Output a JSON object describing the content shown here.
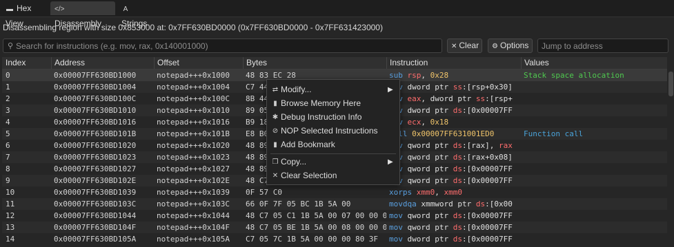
{
  "tabs": [
    {
      "label": "Hex View",
      "icon": "hex-view-icon",
      "glyph": "▬"
    },
    {
      "label": "Disassembly",
      "icon": "code-icon",
      "glyph": "</>"
    },
    {
      "label": "Strings",
      "icon": "strings-icon",
      "glyph": "A"
    }
  ],
  "info": "Disassembling region with size 0x853000 at: 0x7FF630BD0000  (0x7FF630BD0000 - 0x7FF631423000)",
  "toolbar": {
    "search_placeholder": "Search for instructions (e.g. mov, rax, 0x140001000)",
    "clear_label": "Clear",
    "options_label": "Options",
    "address_placeholder": "Jump to address"
  },
  "columns": [
    "Index",
    "Address",
    "Offset",
    "Bytes",
    "Instruction",
    "Values"
  ],
  "rows": [
    {
      "index": "0",
      "address": "0x00007FF630BD1000",
      "offset": "notepad+++0x1000",
      "bytes": "48 83 EC 28",
      "mnemonic": "sub",
      "operands": [
        [
          "rsp",
          "reg"
        ],
        [
          ", ",
          "kw"
        ],
        [
          "0x28",
          "num"
        ]
      ],
      "value": "Stack space allocation"
    },
    {
      "index": "1",
      "address": "0x00007FF630BD1004",
      "offset": "notepad+++0x1004",
      "bytes": "C7 44",
      "mnemonic": "mov",
      "operands": [
        [
          "dword ptr ",
          "kw"
        ],
        [
          "ss",
          "seg"
        ],
        [
          ":[rsp+0x30]",
          "kw"
        ]
      ],
      "value": ""
    },
    {
      "index": "2",
      "address": "0x00007FF630BD100C",
      "offset": "notepad+++0x100C",
      "bytes": "8B 44",
      "mnemonic": "mov",
      "operands": [
        [
          "eax",
          "reg"
        ],
        [
          ", dword ptr ",
          "kw"
        ],
        [
          "ss",
          "seg"
        ],
        [
          ":[rsp+",
          "kw"
        ]
      ],
      "value": ""
    },
    {
      "index": "3",
      "address": "0x00007FF630BD1010",
      "offset": "notepad+++0x1010",
      "bytes": "89 05",
      "mnemonic": "mov",
      "operands": [
        [
          "dword ptr ",
          "kw"
        ],
        [
          "ds",
          "seg"
        ],
        [
          ":[0x00007FF",
          "kw"
        ]
      ],
      "value": ""
    },
    {
      "index": "4",
      "address": "0x00007FF630BD1016",
      "offset": "notepad+++0x1016",
      "bytes": "B9 18",
      "mnemonic": "mov",
      "operands": [
        [
          "ecx",
          "reg"
        ],
        [
          ", ",
          "kw"
        ],
        [
          "0x18",
          "num"
        ]
      ],
      "value": ""
    },
    {
      "index": "5",
      "address": "0x00007FF630BD101B",
      "offset": "notepad+++0x101B",
      "bytes": "E8 B0",
      "mnemonic": "call",
      "operands": [
        [
          "0x00007FF631001ED0",
          "num"
        ]
      ],
      "value": "Function call"
    },
    {
      "index": "6",
      "address": "0x00007FF630BD1020",
      "offset": "notepad+++0x1020",
      "bytes": "48 89",
      "mnemonic": "mov",
      "operands": [
        [
          "qword ptr ",
          "kw"
        ],
        [
          "ds",
          "seg"
        ],
        [
          ":[rax], ",
          "kw"
        ],
        [
          "rax",
          "reg"
        ]
      ],
      "value": ""
    },
    {
      "index": "7",
      "address": "0x00007FF630BD1023",
      "offset": "notepad+++0x1023",
      "bytes": "48 89",
      "mnemonic": "mov",
      "operands": [
        [
          "qword ptr ",
          "kw"
        ],
        [
          "ds",
          "seg"
        ],
        [
          ":[rax+0x08]",
          "kw"
        ]
      ],
      "value": ""
    },
    {
      "index": "8",
      "address": "0x00007FF630BD1027",
      "offset": "notepad+++0x1027",
      "bytes": "48 89",
      "mnemonic": "mov",
      "operands": [
        [
          "qword ptr ",
          "kw"
        ],
        [
          "ds",
          "seg"
        ],
        [
          ":[0x00007FF",
          "kw"
        ]
      ],
      "value": ""
    },
    {
      "index": "9",
      "address": "0x00007FF630BD102E",
      "offset": "notepad+++0x102E",
      "bytes": "48 C7",
      "mnemonic": "mov",
      "operands": [
        [
          "qword ptr ",
          "kw"
        ],
        [
          "ds",
          "seg"
        ],
        [
          ":[0x00007FF",
          "kw"
        ]
      ],
      "value": ""
    },
    {
      "index": "10",
      "address": "0x00007FF630BD1039",
      "offset": "notepad+++0x1039",
      "bytes": "0F 57 C0",
      "mnemonic": "xorps",
      "operands": [
        [
          "xmm0",
          "reg"
        ],
        [
          ", ",
          "kw"
        ],
        [
          "xmm0",
          "reg"
        ]
      ],
      "value": ""
    },
    {
      "index": "11",
      "address": "0x00007FF630BD103C",
      "offset": "notepad+++0x103C",
      "bytes": "66 0F 7F 05 BC 1B 5A 00",
      "mnemonic": "movdqa",
      "operands": [
        [
          "xmmword ptr ",
          "kw"
        ],
        [
          "ds",
          "seg"
        ],
        [
          ":[0x00",
          "kw"
        ]
      ],
      "value": ""
    },
    {
      "index": "12",
      "address": "0x00007FF630BD1044",
      "offset": "notepad+++0x1044",
      "bytes": "48 C7 05 C1 1B 5A 00 07 00 00 00",
      "mnemonic": "mov",
      "operands": [
        [
          "qword ptr ",
          "kw"
        ],
        [
          "ds",
          "seg"
        ],
        [
          ":[0x00007FF",
          "kw"
        ]
      ],
      "value": ""
    },
    {
      "index": "13",
      "address": "0x00007FF630BD104F",
      "offset": "notepad+++0x104F",
      "bytes": "48 C7 05 BE 1B 5A 00 08 00 00 00",
      "mnemonic": "mov",
      "operands": [
        [
          "qword ptr ",
          "kw"
        ],
        [
          "ds",
          "seg"
        ],
        [
          ":[0x00007FF",
          "kw"
        ]
      ],
      "value": ""
    },
    {
      "index": "14",
      "address": "0x00007FF630BD105A",
      "offset": "notepad+++0x105A",
      "bytes": "C7 05 7C 1B 5A 00 00 00 80 3F",
      "mnemonic": "mov",
      "operands": [
        [
          "dword ptr ",
          "kw"
        ],
        [
          "ds",
          "seg"
        ],
        [
          ":[0x00007FF",
          "kw"
        ]
      ],
      "value": ""
    }
  ],
  "context_menu": [
    {
      "label": "Modify...",
      "icon": "modify-icon",
      "glyph": "⇄",
      "submenu": true
    },
    {
      "label": "Browse Memory Here",
      "icon": "browse-memory-icon",
      "glyph": "▮",
      "submenu": false
    },
    {
      "label": "Debug Instruction Info",
      "icon": "bug-icon",
      "glyph": "✱",
      "submenu": false
    },
    {
      "label": "NOP Selected Instructions",
      "icon": "block-icon",
      "glyph": "⊘",
      "submenu": false
    },
    {
      "label": "Add Bookmark",
      "icon": "bookmark-icon",
      "glyph": "▮",
      "submenu": false
    },
    {
      "separator": true
    },
    {
      "label": "Copy...",
      "icon": "copy-icon",
      "glyph": "❐",
      "submenu": true
    },
    {
      "label": "Clear Selection",
      "icon": "close-icon",
      "glyph": "✕",
      "submenu": false
    }
  ]
}
